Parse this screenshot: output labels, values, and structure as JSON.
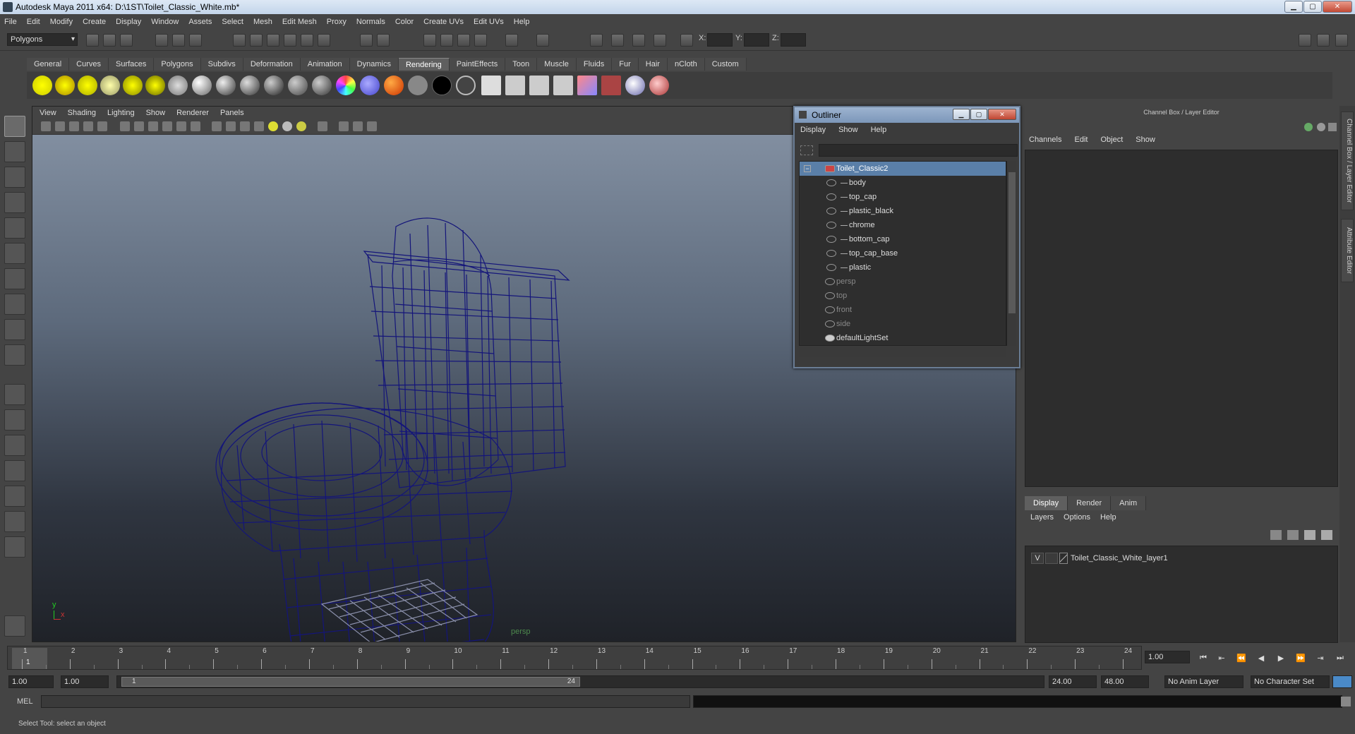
{
  "window": {
    "title": "Autodesk Maya 2011 x64: D:\\1ST\\Toilet_Classic_White.mb*"
  },
  "menubar": [
    "File",
    "Edit",
    "Modify",
    "Create",
    "Display",
    "Window",
    "Assets",
    "Select",
    "Mesh",
    "Edit Mesh",
    "Proxy",
    "Normals",
    "Color",
    "Create UVs",
    "Edit UVs",
    "Help"
  ],
  "statusline": {
    "mode": "Polygons",
    "x_label": "X:",
    "y_label": "Y:",
    "z_label": "Z:"
  },
  "shelf_tabs": [
    "General",
    "Curves",
    "Surfaces",
    "Polygons",
    "Subdivs",
    "Deformation",
    "Animation",
    "Dynamics",
    "Rendering",
    "PaintEffects",
    "Toon",
    "Muscle",
    "Fluids",
    "Fur",
    "Hair",
    "nCloth",
    "Custom"
  ],
  "shelf_active": "Rendering",
  "viewport": {
    "menu": [
      "View",
      "Shading",
      "Lighting",
      "Show",
      "Renderer",
      "Panels"
    ],
    "camera_label": "persp",
    "axis_y": "y",
    "axis_x": "x"
  },
  "outliner": {
    "title": "Outliner",
    "menu": [
      "Display",
      "Show",
      "Help"
    ],
    "rows": [
      {
        "label": "Toilet_Classic2",
        "state": "selected"
      },
      {
        "label": "body",
        "state": "child"
      },
      {
        "label": "top_cap",
        "state": "child"
      },
      {
        "label": "plastic_black",
        "state": "child"
      },
      {
        "label": "chrome",
        "state": "child"
      },
      {
        "label": "bottom_cap",
        "state": "child"
      },
      {
        "label": "top_cap_base",
        "state": "child"
      },
      {
        "label": "plastic",
        "state": "child"
      },
      {
        "label": "persp",
        "state": "camera"
      },
      {
        "label": "top",
        "state": "camera"
      },
      {
        "label": "front",
        "state": "camera"
      },
      {
        "label": "side",
        "state": "camera"
      },
      {
        "label": "defaultLightSet",
        "state": "set"
      }
    ]
  },
  "channelbox": {
    "title": "Channel Box / Layer Editor",
    "menu": [
      "Channels",
      "Edit",
      "Object",
      "Show"
    ]
  },
  "layer_editor": {
    "tabs": [
      "Display",
      "Render",
      "Anim"
    ],
    "active_tab": "Display",
    "menu": [
      "Layers",
      "Options",
      "Help"
    ],
    "layer": {
      "visible": "V",
      "name": "Toilet_Classic_White_layer1"
    }
  },
  "side_tabs": [
    "Channel Box / Layer Editor",
    "Attribute Editor"
  ],
  "timeslider": {
    "ticks": [
      "1",
      "2",
      "3",
      "4",
      "5",
      "6",
      "7",
      "8",
      "9",
      "10",
      "11",
      "12",
      "13",
      "14",
      "15",
      "16",
      "17",
      "18",
      "19",
      "20",
      "21",
      "22",
      "23",
      "24"
    ],
    "current_frame": "1",
    "current_time_field": "1.00"
  },
  "range": {
    "start_time": "1.00",
    "playback_start": "1.00",
    "slider_start": "1",
    "slider_end": "24",
    "playback_end": "24.00",
    "end_time": "48.00",
    "anim_layer": "No Anim Layer",
    "character_set": "No Character Set"
  },
  "commandline": {
    "label": "MEL"
  },
  "helpline": {
    "text": "Select Tool: select an object"
  },
  "colors": {
    "wireframe": "#14157a",
    "selection": "#5a7fa8"
  }
}
